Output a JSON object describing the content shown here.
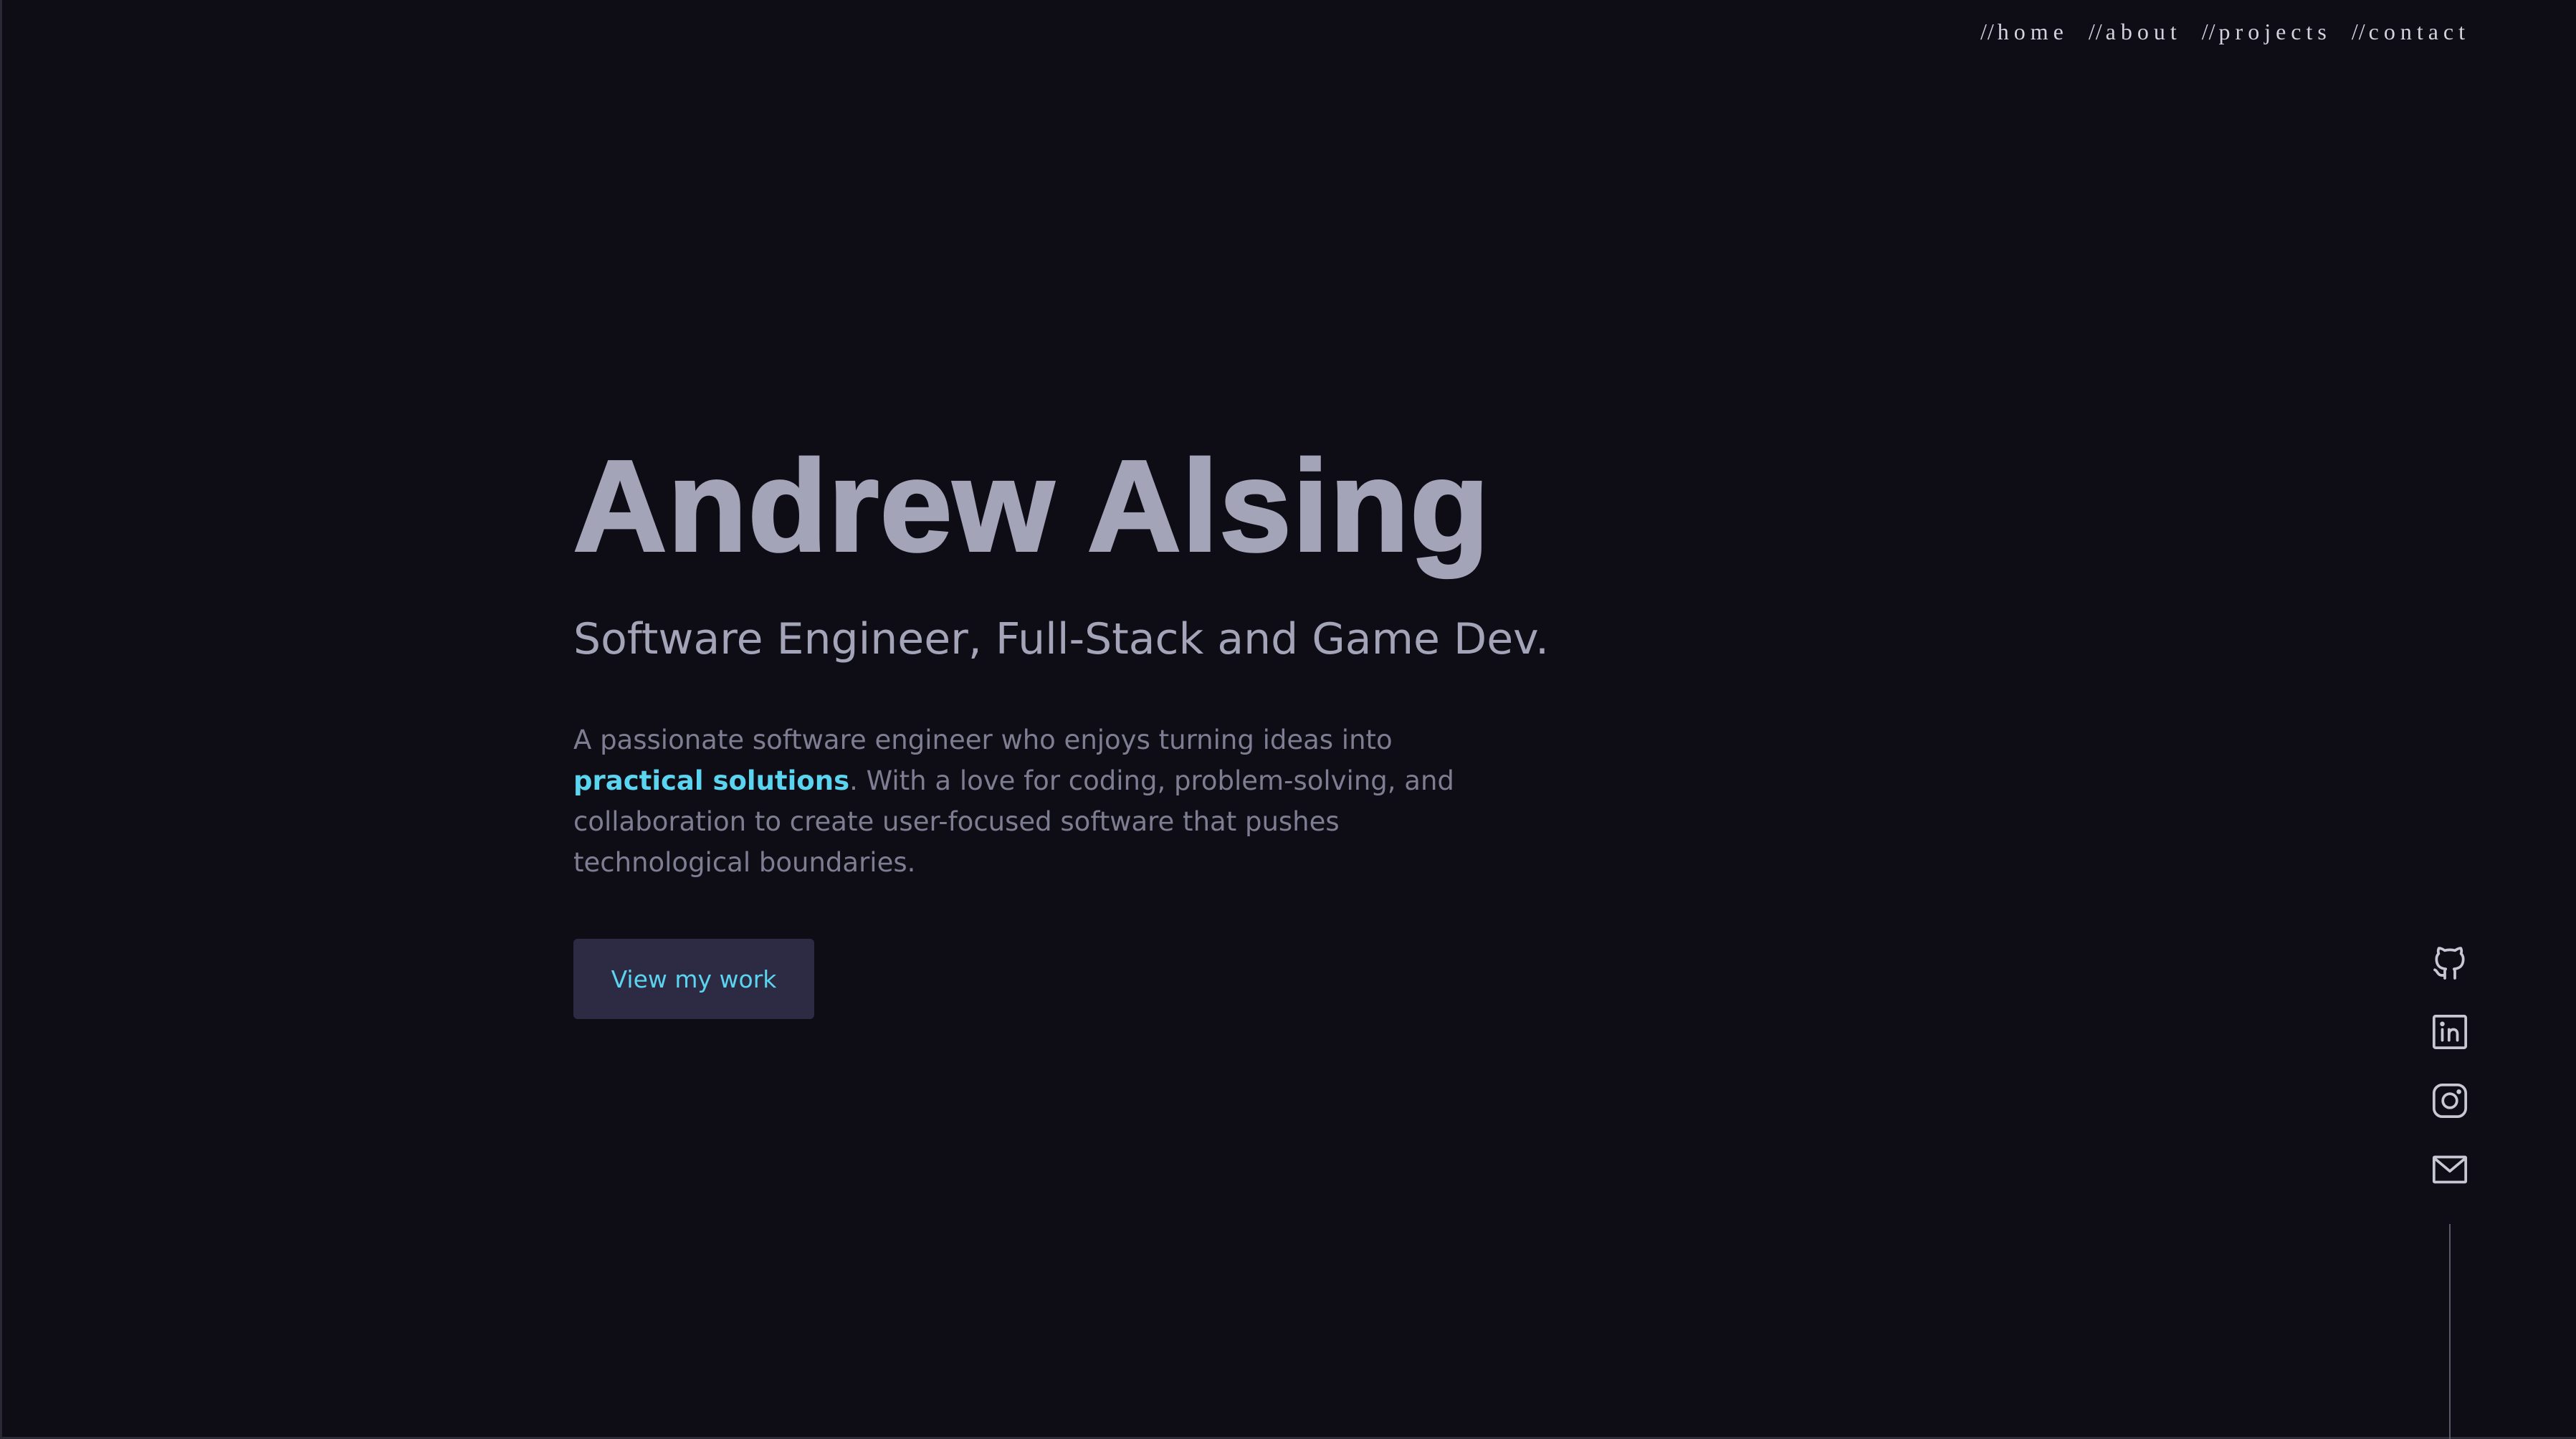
{
  "nav": {
    "items": [
      {
        "prefix": "//",
        "label": "home"
      },
      {
        "prefix": "//",
        "label": "about"
      },
      {
        "prefix": "//",
        "label": "projects"
      },
      {
        "prefix": "//",
        "label": "contact"
      }
    ]
  },
  "hero": {
    "title": "Andrew Alsing",
    "subtitle": "Software Engineer, Full-Stack and Game Dev.",
    "description_before": "A passionate software engineer who enjoys turning ideas into ",
    "description_highlight": "practical solutions",
    "description_after": ". With a love for coding, problem-solving, and collaboration to create user-focused software that pushes technological boundaries.",
    "cta_label": "View my work"
  },
  "social": {
    "icons": [
      "github-icon",
      "linkedin-icon",
      "instagram-icon",
      "mail-icon"
    ]
  },
  "colors": {
    "background": "#0e0d16",
    "title": "#a4a4b8",
    "text": "#7e7d92",
    "accent": "#5bd4f0",
    "button_bg": "#2d2b44",
    "icon": "#c8c8d4"
  }
}
